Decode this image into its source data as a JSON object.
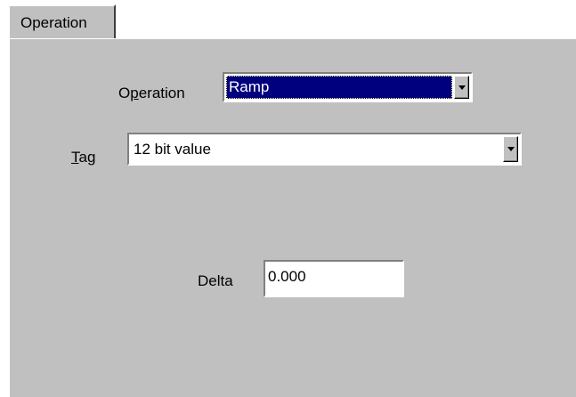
{
  "tabs": [
    {
      "label": "Operation"
    }
  ],
  "form": {
    "operation": {
      "label_prefix": "O",
      "label_accel": "p",
      "label_suffix": "eration",
      "value": "Ramp"
    },
    "tag": {
      "label_accel": "T",
      "label_suffix": "ag",
      "value": "12 bit value"
    },
    "delta": {
      "label": "Delta",
      "value": "0.000"
    }
  },
  "colors": {
    "panel_bg": "#c0c0c0",
    "selection_bg": "#00007f",
    "selection_text": "#ffffff"
  },
  "icons": {
    "dropdown": "chevron-down-icon"
  }
}
